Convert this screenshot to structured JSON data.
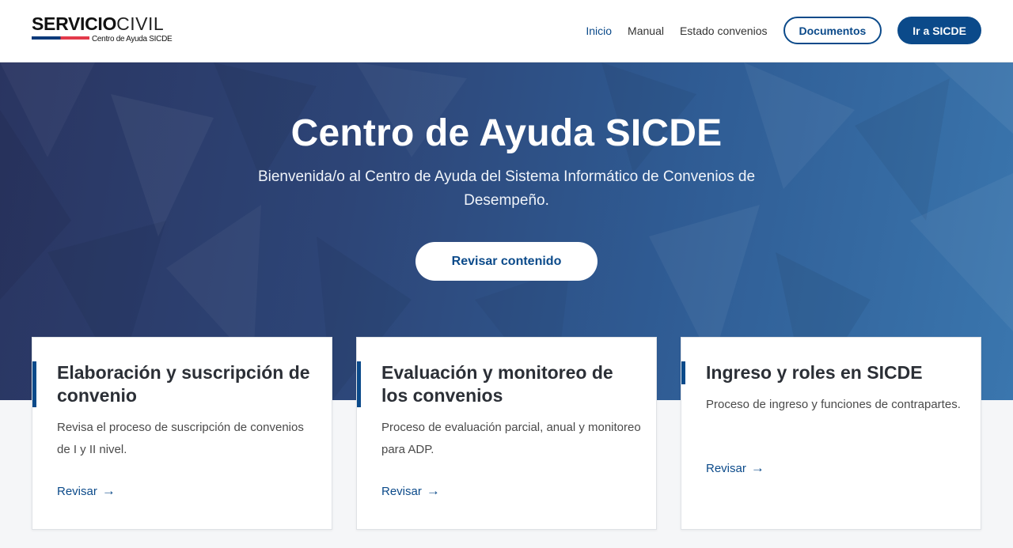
{
  "header": {
    "logo_bold": "SERVICIO",
    "logo_light": "CIVIL",
    "logo_sub": "Centro de Ayuda SICDE",
    "nav": [
      {
        "label": "Inicio",
        "active": true
      },
      {
        "label": "Manual",
        "active": false
      },
      {
        "label": "Estado convenios",
        "active": false
      }
    ],
    "documentos_label": "Documentos",
    "ir_label": "Ir a SICDE"
  },
  "hero": {
    "title": "Centro de Ayuda SICDE",
    "subtitle": "Bienvenida/o al Centro de Ayuda del Sistema Informático de Convenios de Desempeño.",
    "button_label": "Revisar contenido"
  },
  "cards": [
    {
      "title": "Elaboración y suscripción de convenio",
      "description": "Revisa el proceso de suscripción de convenios de I y II nivel.",
      "link_label": "Revisar",
      "arrow": "→"
    },
    {
      "title": "Evaluación y monitoreo de los convenios",
      "description": "Proceso de evaluación parcial, anual y monitoreo para ADP.",
      "link_label": "Revisar",
      "arrow": "→"
    },
    {
      "title": "Ingreso y roles en SICDE",
      "description": "Proceso de ingreso y funciones de contrapartes.",
      "link_label": "Revisar",
      "arrow": "→"
    }
  ],
  "colors": {
    "brand_blue": "#0b4a8a",
    "logo_red": "#e33a4b",
    "hero_dark": "#2a3561",
    "hero_light": "#3a76ae"
  }
}
